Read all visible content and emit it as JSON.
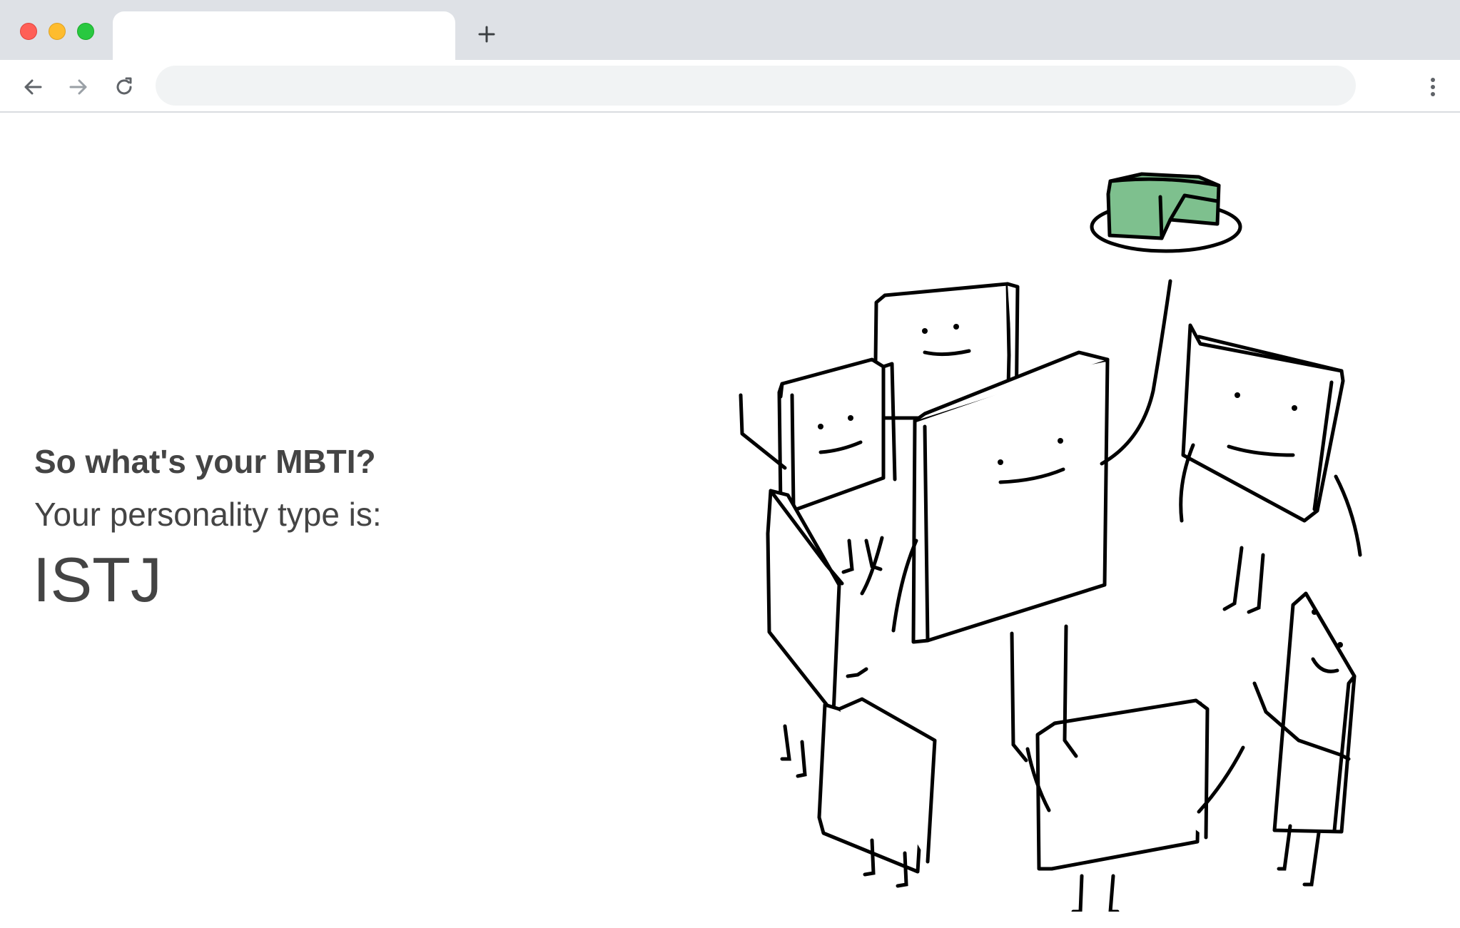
{
  "browser": {
    "tab_title": "",
    "address_value": "",
    "address_placeholder": "",
    "icons": {
      "back": "arrow-left-icon",
      "forward": "arrow-right-icon",
      "reload": "reload-icon",
      "new_tab": "plus-icon",
      "menu": "kebab-menu-icon"
    },
    "colors": {
      "tabstrip": "#dee1e6",
      "omnibox": "#f1f3f4",
      "close": "#ff5f57",
      "minimize": "#febc2e",
      "maximize": "#28c840"
    }
  },
  "page": {
    "question": "So what's your MBTI?",
    "prompt": "Your personality type is:",
    "result": "ISTJ",
    "text_color": "#444444",
    "illustration": {
      "subject": "group of smiling book characters standing in a circle, one holding a plate with green cake",
      "accent_color": "#7ec08e"
    }
  }
}
